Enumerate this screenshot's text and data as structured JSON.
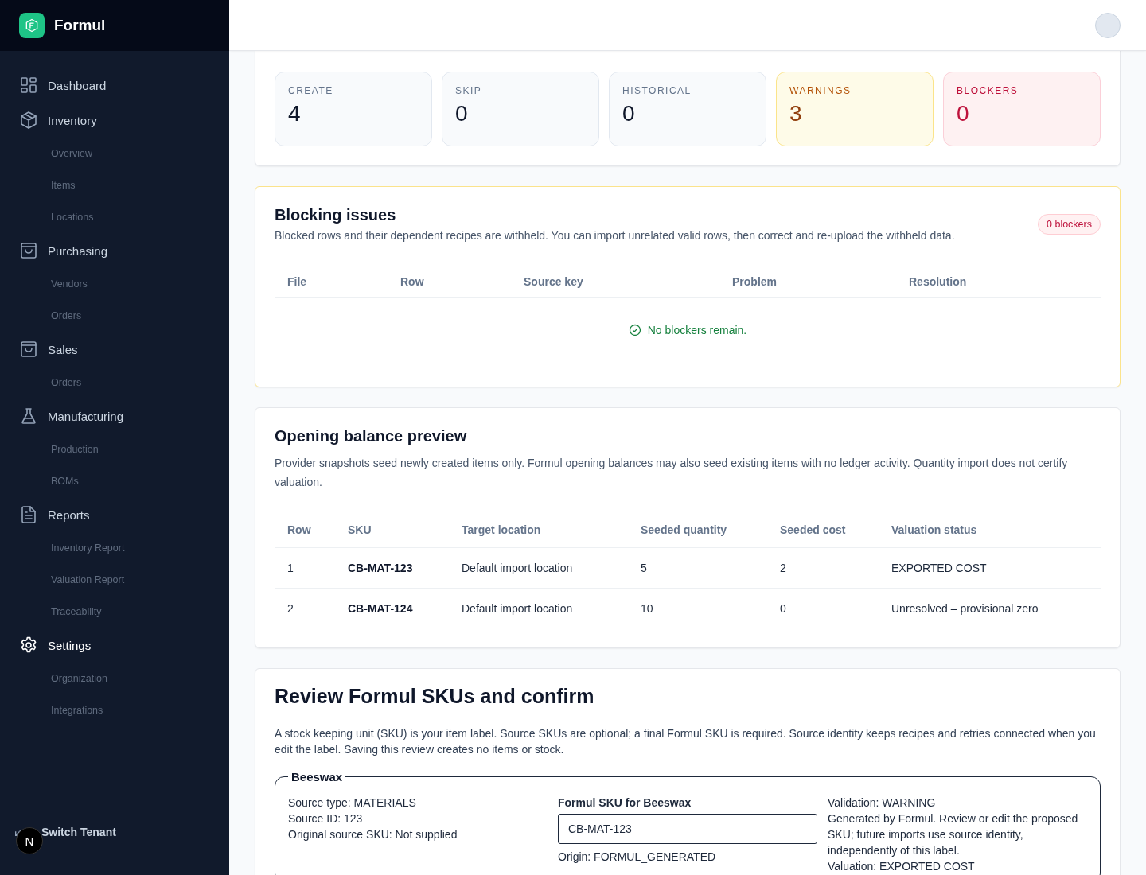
{
  "brand": "Formul",
  "sidebar": {
    "items": [
      {
        "label": "Dashboard",
        "selected": false
      },
      {
        "label": "Inventory",
        "selected": false,
        "children": [
          {
            "label": "Overview"
          },
          {
            "label": "Items"
          },
          {
            "label": "Locations"
          }
        ]
      },
      {
        "label": "Purchasing",
        "selected": false,
        "children": [
          {
            "label": "Vendors"
          },
          {
            "label": "Orders"
          }
        ]
      },
      {
        "label": "Sales",
        "selected": false,
        "children": [
          {
            "label": "Orders"
          }
        ]
      },
      {
        "label": "Manufacturing",
        "selected": false,
        "children": [
          {
            "label": "Production"
          },
          {
            "label": "BOMs"
          }
        ]
      },
      {
        "label": "Reports",
        "selected": false,
        "children": [
          {
            "label": "Inventory Report"
          },
          {
            "label": "Valuation Report"
          },
          {
            "label": "Traceability"
          }
        ]
      },
      {
        "label": "Settings",
        "selected": true,
        "children": [
          {
            "label": "Organization"
          },
          {
            "label": "Integrations"
          }
        ]
      }
    ],
    "footer": "Switch Tenant",
    "dev_badge": "N"
  },
  "stats": [
    {
      "label": "CREATE",
      "value": "4",
      "kind": "neutral"
    },
    {
      "label": "SKIP",
      "value": "0",
      "kind": "neutral"
    },
    {
      "label": "HISTORICAL",
      "value": "0",
      "kind": "neutral"
    },
    {
      "label": "WARNINGS",
      "value": "3",
      "kind": "warning"
    },
    {
      "label": "BLOCKERS",
      "value": "0",
      "kind": "danger"
    }
  ],
  "blocking": {
    "title": "Blocking issues",
    "description": "Blocked rows and their dependent recipes are withheld. You can import unrelated valid rows, then correct and re-upload the withheld data.",
    "badge": "0 blockers",
    "columns": [
      "File",
      "Row",
      "Source key",
      "Problem",
      "Resolution"
    ],
    "empty": "No blockers remain."
  },
  "opening": {
    "title": "Opening balance preview",
    "description": "Provider snapshots seed newly created items only. Formul opening balances may also seed existing items with no ledger activity. Quantity import does not certify valuation.",
    "columns": [
      "Row",
      "SKU",
      "Target location",
      "Seeded quantity",
      "Seeded cost",
      "Valuation status"
    ],
    "rows": [
      [
        "1",
        "CB-MAT-123",
        "Default import location",
        "5",
        "2",
        "EXPORTED COST"
      ],
      [
        "2",
        "CB-MAT-124",
        "Default import location",
        "10",
        "0",
        "Unresolved – provisional zero"
      ]
    ]
  },
  "review": {
    "title": "Review Formul SKUs and confirm",
    "description": "A stock keeping unit (SKU) is your item label. Source SKUs are optional; a final Formul SKU is required. Source identity keeps recipes and retries connected when you edit the label. Saving this review creates no items or stock.",
    "items": [
      {
        "name": "Beeswax",
        "source": [
          "Source type: MATERIALS",
          "Source ID: 123",
          "Original source SKU: Not supplied"
        ],
        "field_label": "Formul SKU for Beeswax",
        "value": "CB-MAT-123",
        "origin": "Origin: FORMUL_GENERATED",
        "notes": [
          "Validation: WARNING",
          "Generated by Formul. Review or edit the proposed SKU; future imports use source identity, independently of this label.",
          "Valuation: EXPORTED COST"
        ]
      }
    ]
  }
}
